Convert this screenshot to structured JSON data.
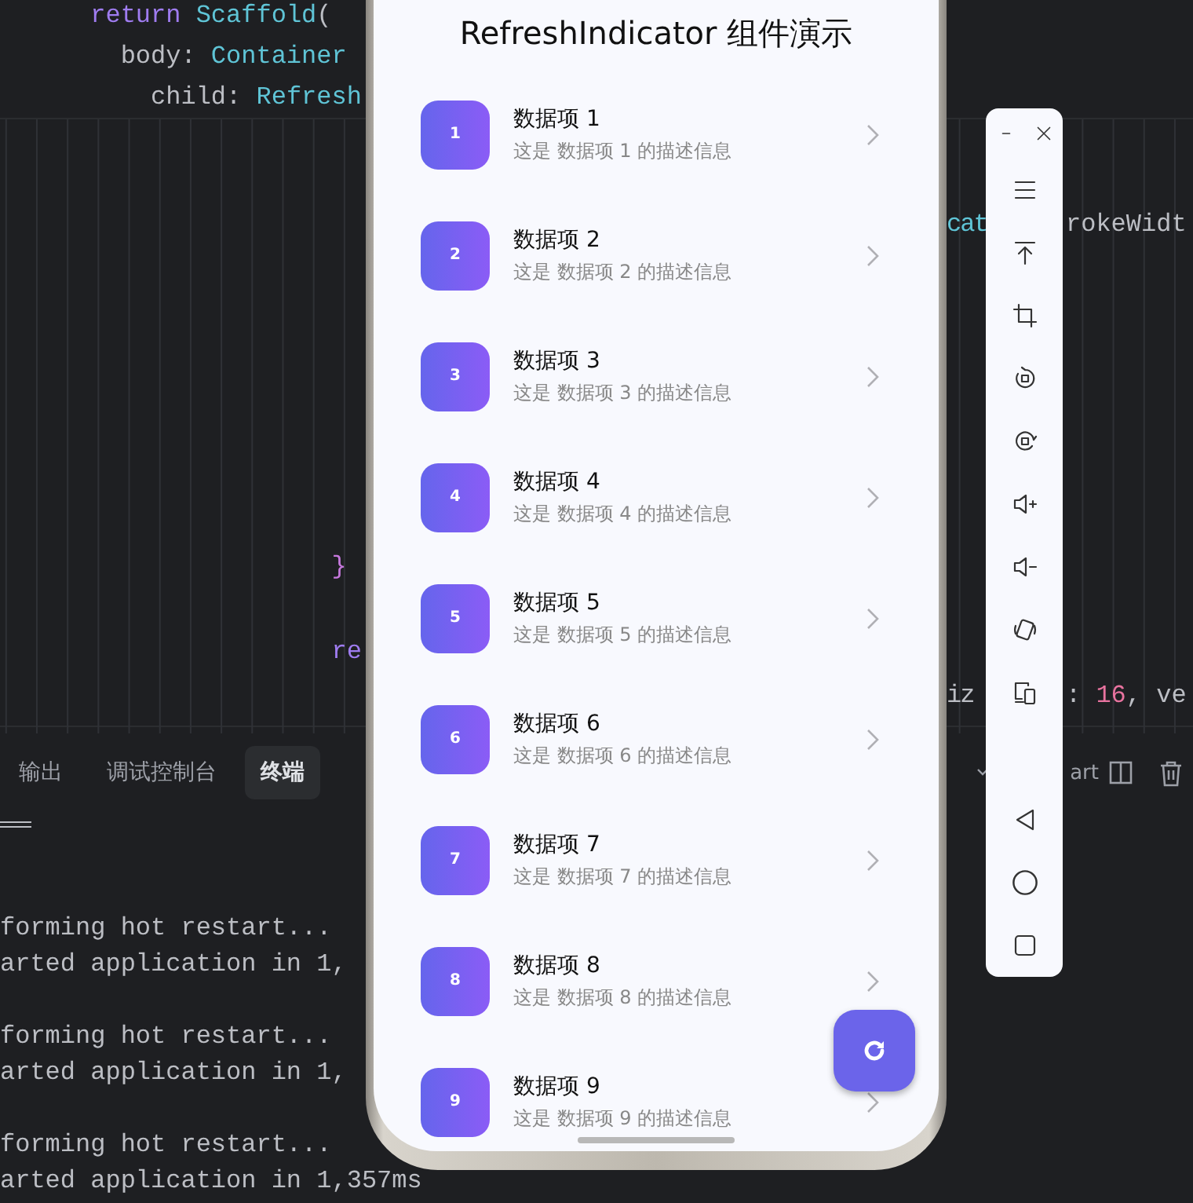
{
  "editor": {
    "sticky_lines": [
      {
        "left": [
          {
            "text": "      return ",
            "kind": "keyword"
          },
          {
            "text": "Scaffold",
            "kind": "type"
          },
          {
            "text": "(",
            "kind": "plain"
          }
        ]
      },
      {
        "left": [
          {
            "text": "        body: ",
            "kind": "plain"
          },
          {
            "text": "Container",
            "kind": "type"
          }
        ]
      },
      {
        "left": [
          {
            "text": "          child: ",
            "kind": "plain"
          },
          {
            "text": "Refresh",
            "kind": "type"
          }
        ]
      }
    ],
    "lines": [
      {
        "mid": [
          {
            "text": "cat",
            "kind": "type"
          }
        ],
        "right": [
          {
            "text": "rokeWidt",
            "kind": "plain"
          }
        ]
      },
      {
        "left": [
          {
            "text": "                      }",
            "kind": "brace"
          }
        ]
      },
      {
        "left": [
          {
            "text": "                      re",
            "kind": "keyword"
          }
        ]
      },
      {
        "mid": [
          {
            "text": "iz",
            "kind": "plain"
          }
        ],
        "right": [
          {
            "text": ": ",
            "kind": "plain"
          },
          {
            "text": "16",
            "kind": "number"
          },
          {
            "text": ", ve",
            "kind": "plain"
          }
        ]
      }
    ]
  },
  "panel": {
    "tabs": [
      {
        "label": "输出",
        "selected": false
      },
      {
        "label": "调试控制台",
        "selected": false
      },
      {
        "label": "终端",
        "selected": true
      }
    ],
    "action_text": "art",
    "terminal_lines": [
      {
        "text": "forming hot restart..."
      },
      {
        "text": "arted application in 1,"
      },
      {
        "text": "forming hot restart..."
      },
      {
        "text": "arted application in 1,"
      },
      {
        "text": "forming hot restart..."
      },
      {
        "text": "arted application in 1,357ms"
      }
    ]
  },
  "phone": {
    "title": "RefreshIndicator 组件演示",
    "items": [
      {
        "number": "1",
        "title": "数据项 1",
        "subtitle": "这是 数据项 1 的描述信息"
      },
      {
        "number": "2",
        "title": "数据项 2",
        "subtitle": "这是 数据项 2 的描述信息"
      },
      {
        "number": "3",
        "title": "数据项 3",
        "subtitle": "这是 数据项 3 的描述信息"
      },
      {
        "number": "4",
        "title": "数据项 4",
        "subtitle": "这是 数据项 4 的描述信息"
      },
      {
        "number": "5",
        "title": "数据项 5",
        "subtitle": "这是 数据项 5 的描述信息"
      },
      {
        "number": "6",
        "title": "数据项 6",
        "subtitle": "这是 数据项 6 的描述信息"
      },
      {
        "number": "7",
        "title": "数据项 7",
        "subtitle": "这是 数据项 7 的描述信息"
      },
      {
        "number": "8",
        "title": "数据项 8",
        "subtitle": "这是 数据项 8 的描述信息"
      },
      {
        "number": "9",
        "title": "数据项 9",
        "subtitle": "这是 数据项 9 的描述信息"
      }
    ]
  }
}
